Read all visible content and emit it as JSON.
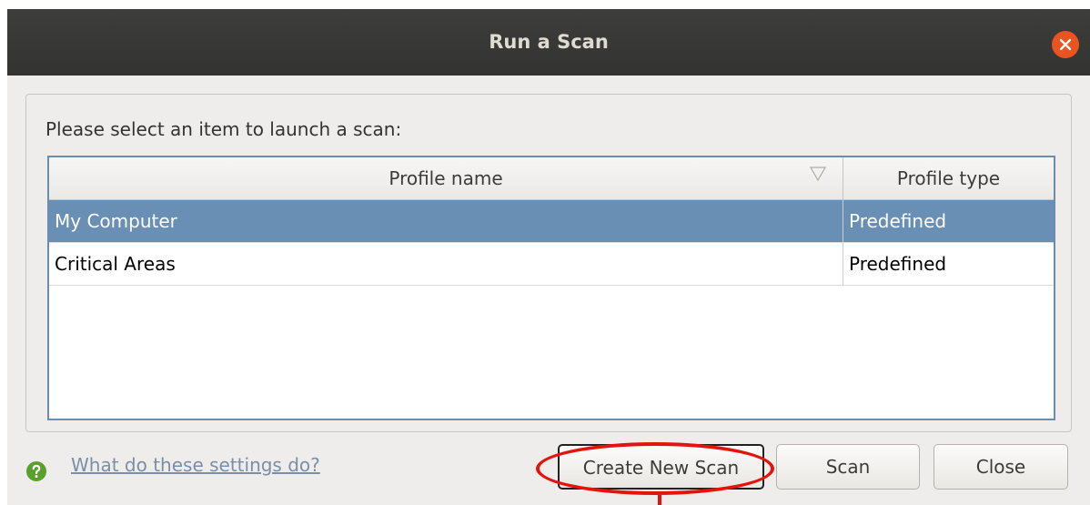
{
  "window": {
    "title": "Run a Scan"
  },
  "prompt": "Please select an item to launch a scan:",
  "table": {
    "columns": [
      "Profile name",
      "Profile type"
    ],
    "rows": [
      {
        "name": "My Computer",
        "type": "Predefined",
        "selected": true
      },
      {
        "name": "Critical Areas",
        "type": "Predefined",
        "selected": false
      }
    ]
  },
  "help": {
    "link_text": "What do these settings do?",
    "icon": "question-icon"
  },
  "buttons": {
    "create_new_scan": "Create New Scan",
    "scan": "Scan",
    "close": "Close"
  },
  "colors": {
    "titlebar": "#3a3a38",
    "close_button": "#e95420",
    "selection": "#6a8fb5",
    "annotation": "#e3130d",
    "help_icon": "#5aa02c"
  }
}
